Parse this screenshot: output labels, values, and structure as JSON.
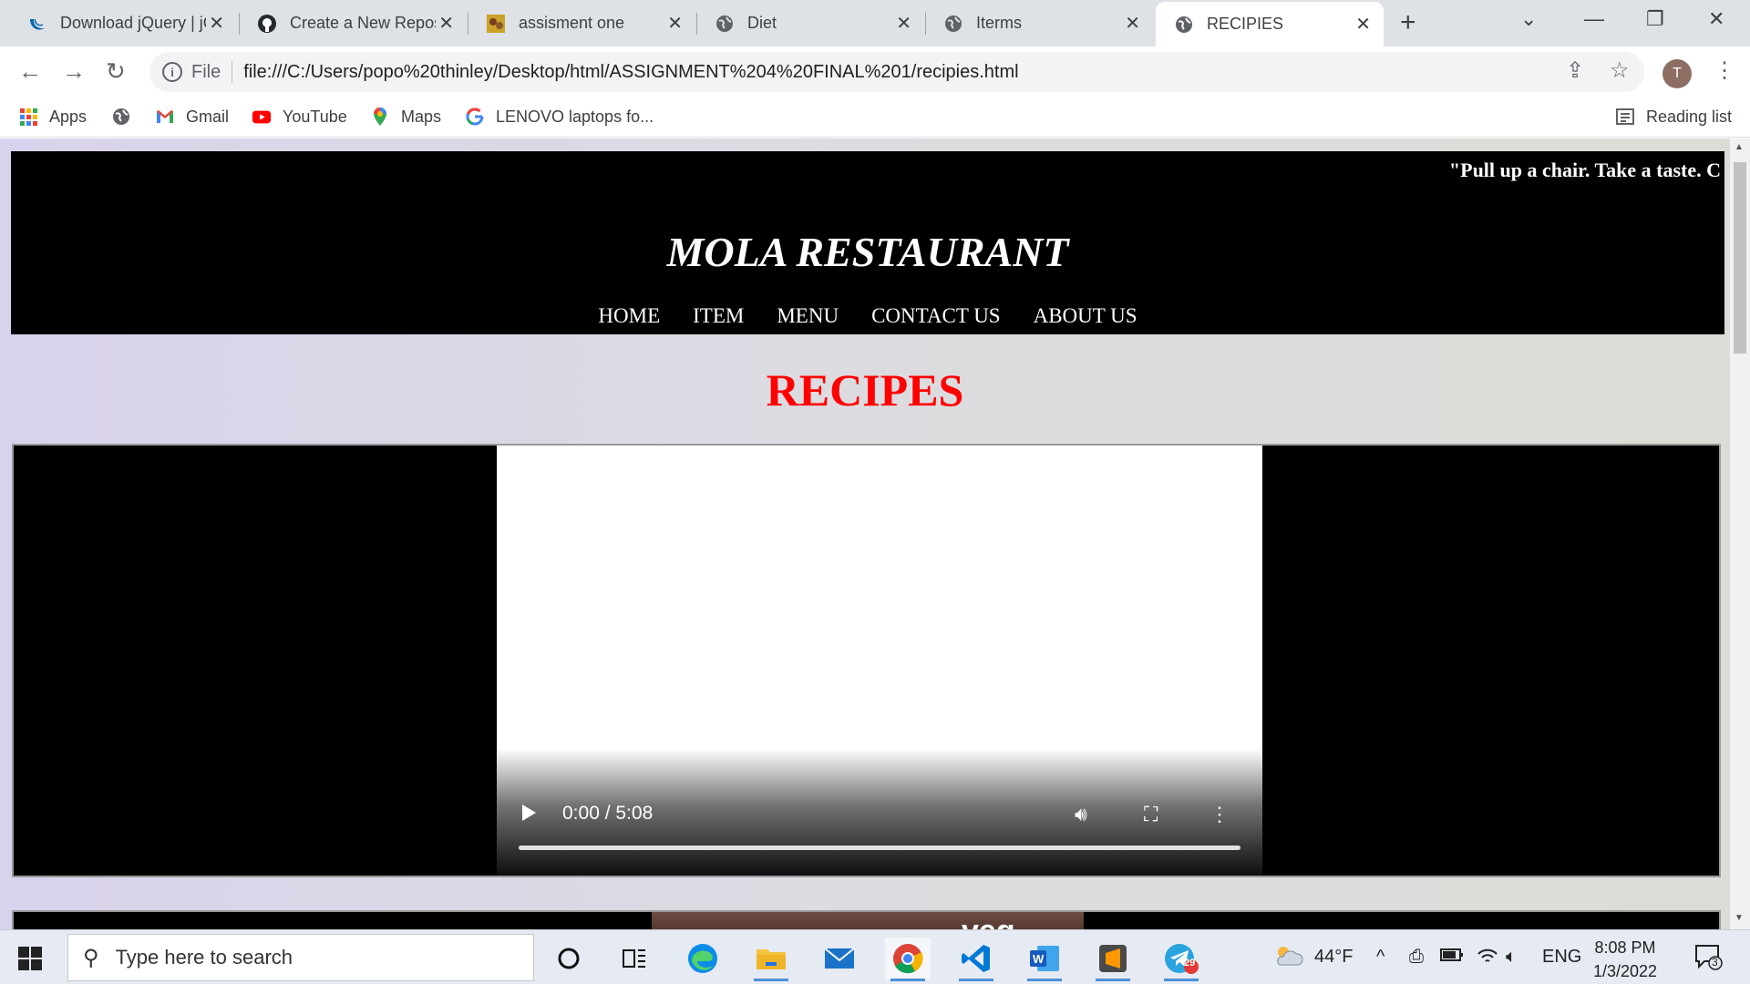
{
  "browser": {
    "tabs": [
      {
        "label": "Download jQuery | jQuery",
        "icon": "jquery-icon"
      },
      {
        "label": "Create a New Repository",
        "icon": "github-icon"
      },
      {
        "label": "assisment one",
        "icon": "image-favicon-icon"
      },
      {
        "label": "Diet",
        "icon": "globe-icon"
      },
      {
        "label": "Iterms",
        "icon": "globe-icon"
      },
      {
        "label": "RECIPIES",
        "icon": "globe-icon",
        "active": true
      }
    ],
    "scheme_label": "File",
    "url": "file:///C:/Users/popo%20thinley/Desktop/html/ASSIGNMENT%204%20FINAL%201/recipies.html",
    "avatar_letter": "T",
    "bookmarks": [
      {
        "label": "Apps",
        "icon": "apps-grid-icon"
      },
      {
        "label": "",
        "icon": "globe-icon"
      },
      {
        "label": "Gmail",
        "icon": "gmail-icon"
      },
      {
        "label": "YouTube",
        "icon": "youtube-icon"
      },
      {
        "label": "Maps",
        "icon": "maps-icon"
      },
      {
        "label": "LENOVO laptops fo...",
        "icon": "google-icon"
      }
    ],
    "reading_list_label": "Reading list"
  },
  "site": {
    "marquee": "\"Pull up a chair. Take a taste. C",
    "brand": "MOLA RESTAURANT",
    "nav": [
      "HOME",
      "ITEM",
      "MENU",
      "CONTACT US",
      "ABOUT US"
    ],
    "heading": "RECIPES",
    "video": {
      "time": "0:00 / 5:08",
      "progress": 0
    },
    "video2_thumb_text": "veg"
  },
  "taskbar": {
    "search_placeholder": "Type here to search",
    "apps": [
      "cortana-icon",
      "task-view-icon",
      "edge-icon",
      "file-explorer-icon",
      "mail-icon",
      "chrome-icon",
      "vscode-icon",
      "word-icon",
      "sublime-icon",
      "telegram-icon"
    ],
    "telegram_badge": "29",
    "weather": "44°F",
    "language": "ENG",
    "time": "8:08 PM",
    "date": "1/3/2022",
    "notification_count": "3"
  }
}
